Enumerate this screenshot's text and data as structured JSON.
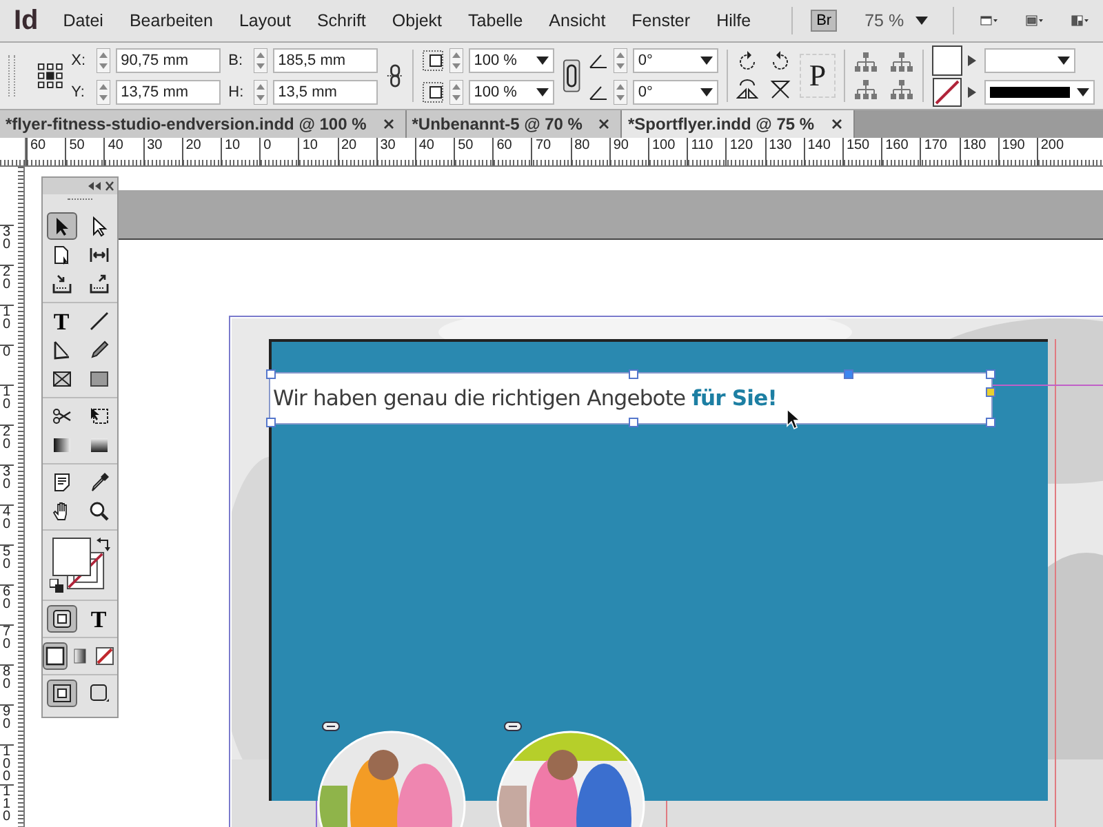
{
  "menu_bar": {
    "logo": "Id",
    "items": [
      "Datei",
      "Bearbeiten",
      "Layout",
      "Schrift",
      "Objekt",
      "Tabelle",
      "Ansicht",
      "Fenster",
      "Hilfe"
    ],
    "bridge_button": "Br",
    "zoom": "75 %"
  },
  "control_panel": {
    "position_fields": [
      {
        "label": "X:",
        "value": "90,75 mm"
      },
      {
        "label": "Y:",
        "value": "13,75 mm"
      }
    ],
    "size_fields": [
      {
        "label": "B:",
        "value": "185,5 mm"
      },
      {
        "label": "H:",
        "value": "13,5 mm"
      }
    ],
    "scale_fields": [
      "100 %",
      "100 %"
    ],
    "angle_fields": [
      "0°",
      "0°"
    ],
    "text_wrap_glyph": "P"
  },
  "tabs": [
    {
      "label": "*flyer-fitness-studio-endversion.indd @ 100 %",
      "selected": false
    },
    {
      "label": "*Unbenannt-5 @ 70 %",
      "selected": false
    },
    {
      "label": "*Sportflyer.indd @ 75 %",
      "selected": true
    }
  ],
  "rulers": {
    "horizontal": [
      "60",
      "50",
      "40",
      "30",
      "20",
      "10",
      "0",
      "10",
      "20",
      "30",
      "40",
      "50",
      "60",
      "70",
      "80",
      "90",
      "100",
      "110",
      "120",
      "130",
      "140",
      "150",
      "160",
      "170",
      "180",
      "190",
      "200"
    ],
    "vertical": [
      "30",
      "20",
      "10",
      "0",
      "10",
      "20",
      "30",
      "40",
      "50",
      "60",
      "70",
      "80",
      "90",
      "100",
      "110"
    ]
  },
  "tools": {
    "groups": [
      {
        "rows": [
          {
            "tools": [
              {
                "kind": "selection",
                "selected": true
              },
              {
                "kind": "direct-selection",
                "selected": false
              }
            ]
          },
          {
            "tools": [
              {
                "kind": "page",
                "selected": false
              },
              {
                "kind": "gap",
                "selected": false
              }
            ]
          },
          {
            "tools": [
              {
                "kind": "collector",
                "selected": false
              },
              {
                "kind": "placer",
                "selected": false
              }
            ]
          }
        ]
      },
      {
        "rows": [
          {
            "tools": [
              {
                "kind": "type",
                "glyph": "T",
                "selected": false
              },
              {
                "kind": "line",
                "selected": false
              }
            ]
          },
          {
            "tools": [
              {
                "kind": "pen",
                "selected": false
              },
              {
                "kind": "pencil",
                "selected": false
              }
            ]
          },
          {
            "tools": [
              {
                "kind": "rectangle-frame",
                "selected": false
              },
              {
                "kind": "rectangle",
                "selected": false
              }
            ]
          }
        ]
      },
      {
        "rows": [
          {
            "tools": [
              {
                "kind": "scissors",
                "selected": false
              },
              {
                "kind": "free-transform",
                "selected": false
              }
            ]
          },
          {
            "tools": [
              {
                "kind": "gradient",
                "selected": false
              },
              {
                "kind": "gradient-feather",
                "selected": false
              }
            ]
          }
        ]
      },
      {
        "rows": [
          {
            "tools": [
              {
                "kind": "note",
                "selected": false
              },
              {
                "kind": "eyedropper",
                "selected": false
              }
            ]
          },
          {
            "tools": [
              {
                "kind": "hand",
                "selected": false
              },
              {
                "kind": "zoom",
                "selected": false
              }
            ]
          }
        ]
      },
      {
        "rows": [
          {
            "tools": [
              {
                "kind": "fill-stroke"
              }
            ]
          }
        ]
      },
      {
        "rows": [
          {
            "tools": [
              {
                "kind": "container",
                "selected": true
              },
              {
                "kind": "format-text",
                "glyph": "T",
                "selected": false
              }
            ]
          }
        ]
      },
      {
        "rows": [
          {
            "tools": [
              {
                "kind": "color",
                "selected": true
              },
              {
                "kind": "gradient-small",
                "selected": false
              },
              {
                "kind": "none",
                "selected": false
              }
            ]
          }
        ]
      },
      {
        "rows": [
          {
            "tools": [
              {
                "kind": "normal-view",
                "selected": true
              },
              {
                "kind": "screen-mode",
                "selected": false
              }
            ]
          }
        ]
      }
    ]
  },
  "document": {
    "headline": "Wir haben genau die richtigen Angebote **für Sie!**"
  }
}
